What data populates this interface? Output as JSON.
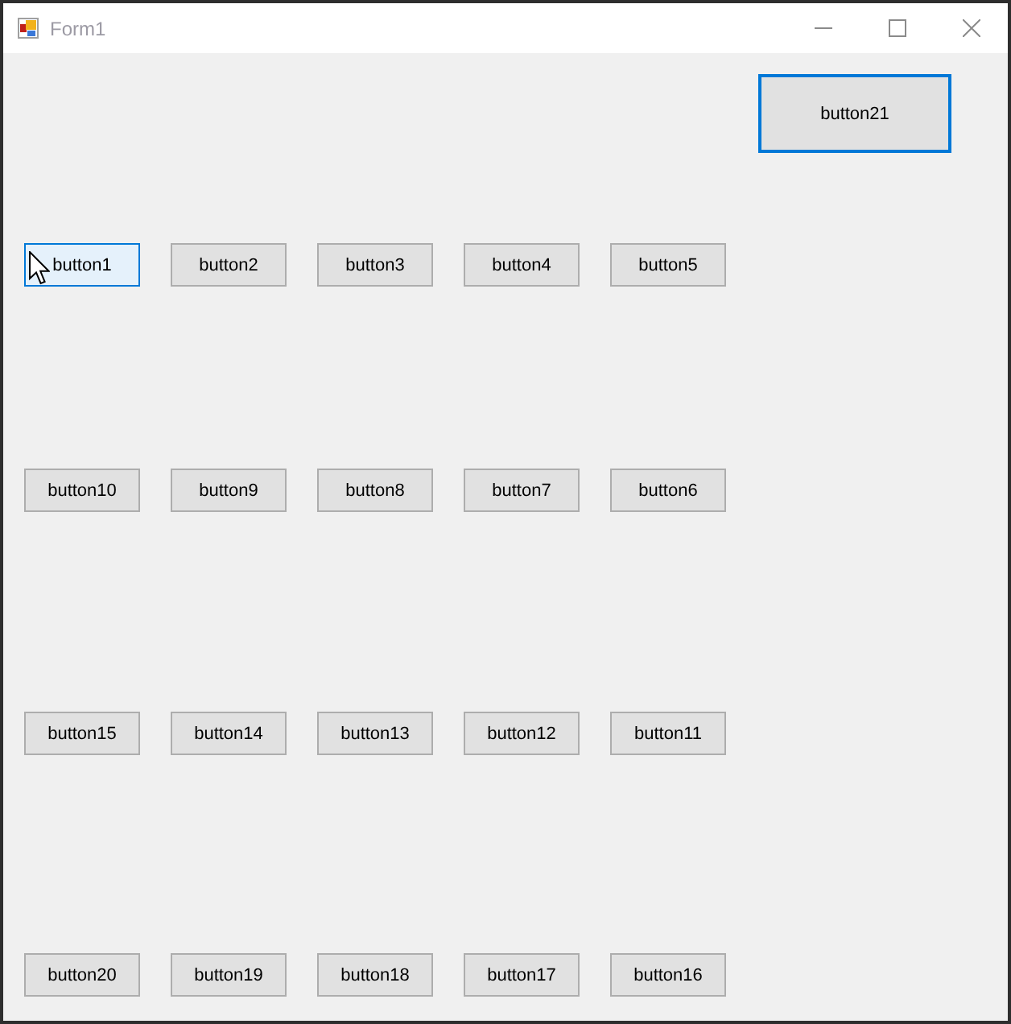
{
  "window": {
    "title": "Form1"
  },
  "top_button": {
    "label": "button21",
    "focused": true,
    "hovered": false
  },
  "button_rows": [
    {
      "buttons": [
        {
          "label": "button1",
          "hovered": true,
          "focused": false
        },
        {
          "label": "button2",
          "hovered": false,
          "focused": false
        },
        {
          "label": "button3",
          "hovered": false,
          "focused": false
        },
        {
          "label": "button4",
          "hovered": false,
          "focused": false
        },
        {
          "label": "button5",
          "hovered": false,
          "focused": false
        }
      ]
    },
    {
      "buttons": [
        {
          "label": "button10",
          "hovered": false,
          "focused": false
        },
        {
          "label": "button9",
          "hovered": false,
          "focused": false
        },
        {
          "label": "button8",
          "hovered": false,
          "focused": false
        },
        {
          "label": "button7",
          "hovered": false,
          "focused": false
        },
        {
          "label": "button6",
          "hovered": false,
          "focused": false
        }
      ]
    },
    {
      "buttons": [
        {
          "label": "button15",
          "hovered": false,
          "focused": false
        },
        {
          "label": "button14",
          "hovered": false,
          "focused": false
        },
        {
          "label": "button13",
          "hovered": false,
          "focused": false
        },
        {
          "label": "button12",
          "hovered": false,
          "focused": false
        },
        {
          "label": "button11",
          "hovered": false,
          "focused": false
        }
      ]
    },
    {
      "buttons": [
        {
          "label": "button20",
          "hovered": false,
          "focused": false
        },
        {
          "label": "button19",
          "hovered": false,
          "focused": false
        },
        {
          "label": "button18",
          "hovered": false,
          "focused": false
        },
        {
          "label": "button17",
          "hovered": false,
          "focused": false
        },
        {
          "label": "button16",
          "hovered": false,
          "focused": false
        }
      ]
    }
  ]
}
